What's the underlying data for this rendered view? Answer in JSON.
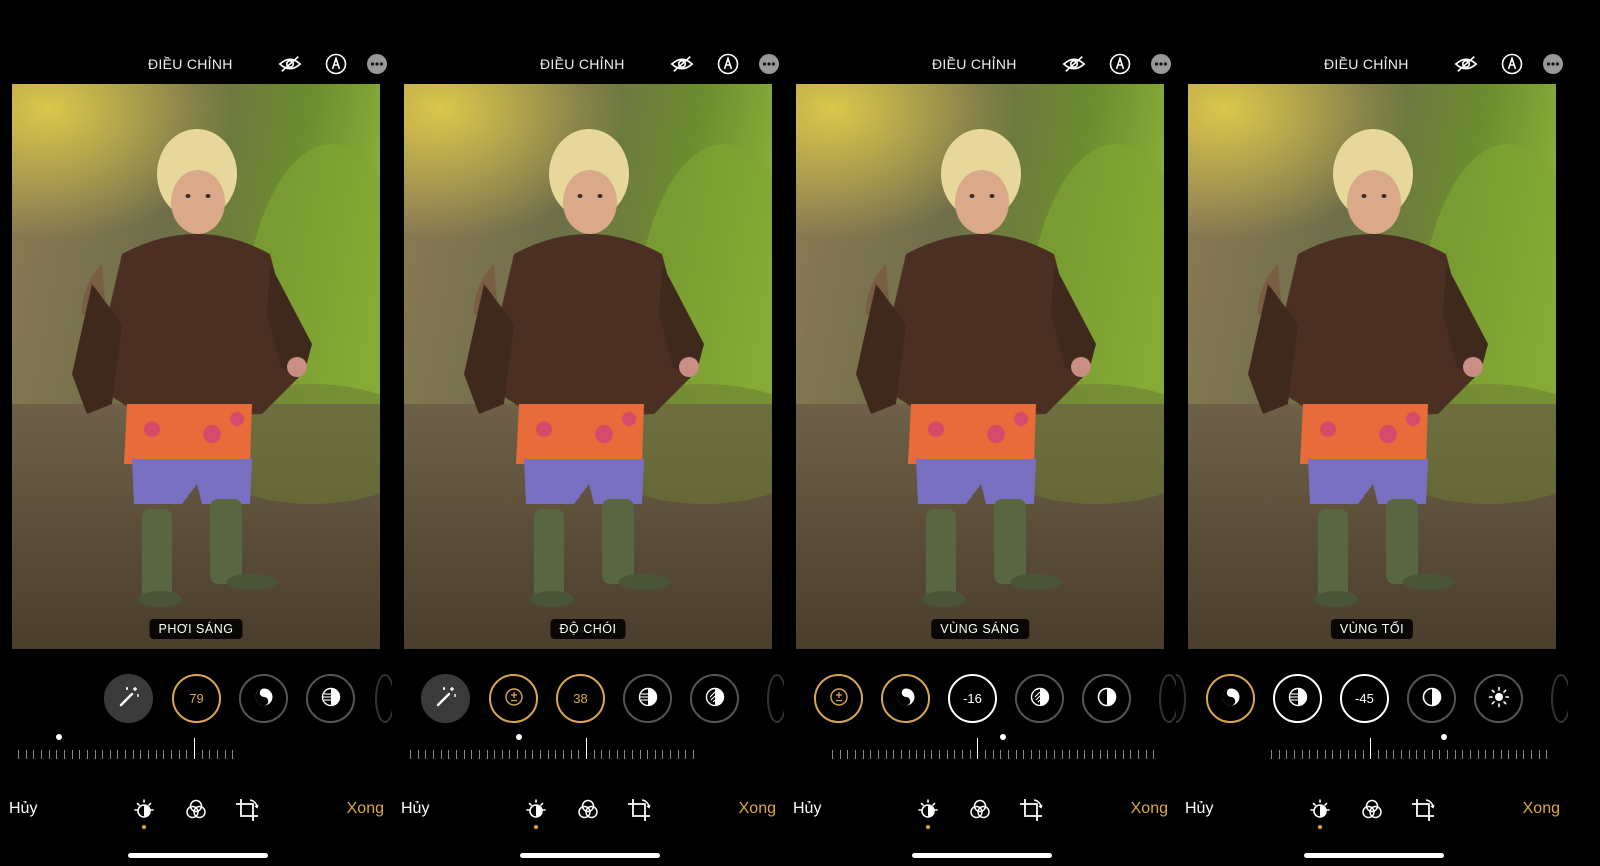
{
  "panels": [
    {
      "title": "ĐIỀU CHỈNH",
      "photo_label": "PHƠI SÁNG",
      "cancel": "Hủy",
      "done": "Xong",
      "tools": [
        {
          "kind": "wand",
          "icon": "magic-wand-icon",
          "value": ""
        },
        {
          "kind": "exposure",
          "icon": "exposure-icon",
          "value": "79",
          "state": "selected"
        },
        {
          "kind": "brilliance",
          "icon": "brilliance-icon",
          "value": ""
        },
        {
          "kind": "highlights",
          "icon": "highlights-icon",
          "value": ""
        }
      ]
    },
    {
      "title": "ĐIỀU CHỈNH",
      "photo_label": "ĐỘ CHÓI",
      "cancel": "Hủy",
      "done": "Xong",
      "tools": [
        {
          "kind": "wand",
          "icon": "magic-wand-icon",
          "value": ""
        },
        {
          "kind": "exposure",
          "icon": "exposure-icon",
          "value": ""
        },
        {
          "kind": "brilliance",
          "icon": "brilliance-icon",
          "value": "38",
          "state": "selected"
        },
        {
          "kind": "highlights",
          "icon": "highlights-icon",
          "value": ""
        },
        {
          "kind": "shadows",
          "icon": "shadows-icon",
          "value": ""
        }
      ]
    },
    {
      "title": "ĐIỀU CHỈNH",
      "photo_label": "VÙNG SÁNG",
      "cancel": "Hủy",
      "done": "Xong",
      "tools": [
        {
          "kind": "exposure",
          "icon": "exposure-icon",
          "value": ""
        },
        {
          "kind": "brilliance",
          "icon": "brilliance-icon",
          "value": ""
        },
        {
          "kind": "highlights",
          "icon": "highlights-icon",
          "value": "-16",
          "state": "selected"
        },
        {
          "kind": "shadows",
          "icon": "shadows-icon",
          "value": ""
        },
        {
          "kind": "contrast",
          "icon": "contrast-icon",
          "value": ""
        }
      ]
    },
    {
      "title": "ĐIỀU CHỈNH",
      "photo_label": "VÙNG TỐI",
      "cancel": "Hủy",
      "done": "Xong",
      "tools": [
        {
          "kind": "brilliance",
          "icon": "brilliance-icon",
          "value": ""
        },
        {
          "kind": "highlights",
          "icon": "highlights-icon",
          "value": ""
        },
        {
          "kind": "shadows",
          "icon": "shadows-icon",
          "value": "-45",
          "state": "selected"
        },
        {
          "kind": "contrast",
          "icon": "contrast-icon",
          "value": ""
        },
        {
          "kind": "brightness",
          "icon": "brightness-icon",
          "value": ""
        }
      ]
    }
  ],
  "colors": {
    "accent": "#e0a83e",
    "background": "#000000"
  }
}
